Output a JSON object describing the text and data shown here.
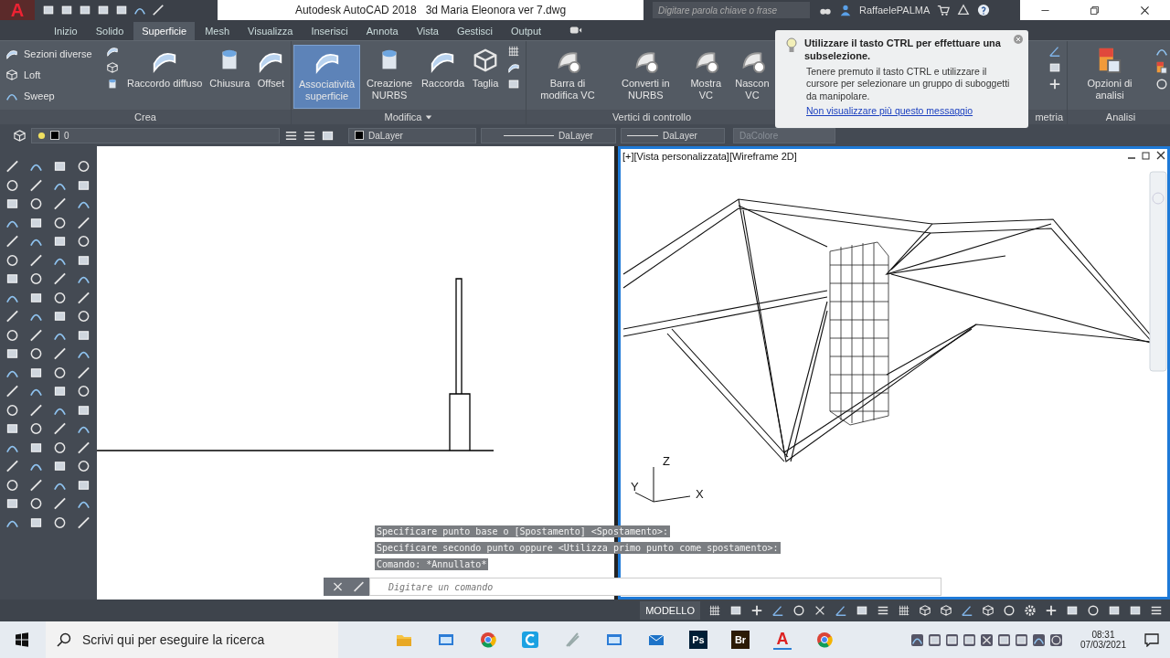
{
  "title_bar": {
    "logo": "A",
    "title": "Autodesk AutoCAD 2018",
    "file": "3d Maria Eleonora ver 7.dwg",
    "search": {
      "placeholder": "Digitare parola chiave o frase"
    },
    "user": "RaffaelePALMA"
  },
  "tabs": [
    {
      "label": "Inizio",
      "selected": false
    },
    {
      "label": "Solido",
      "selected": false
    },
    {
      "label": "Superficie",
      "selected": true
    },
    {
      "label": "Mesh",
      "selected": false
    },
    {
      "label": "Visualizza",
      "selected": false
    },
    {
      "label": "Inserisci",
      "selected": false
    },
    {
      "label": "Annota",
      "selected": false
    },
    {
      "label": "Vista",
      "selected": false
    },
    {
      "label": "Gestisci",
      "selected": false
    },
    {
      "label": "Output",
      "selected": false
    }
  ],
  "ribbon": {
    "panels": [
      {
        "label": "Crea",
        "small": [
          {
            "label": "Sezioni diverse"
          },
          {
            "label": "Loft"
          },
          {
            "label": "Sweep"
          }
        ],
        "buttons": [
          {
            "label": "Raccordo diffuso",
            "selected": false
          },
          {
            "label": "Chiusura",
            "selected": false
          },
          {
            "label": "Offset",
            "selected": false
          }
        ]
      },
      {
        "label": "Modifica",
        "dropdown": true,
        "buttons": [
          {
            "label": "Associatività superficie",
            "selected": true
          },
          {
            "label": "Creazione NURBS",
            "selected": false
          },
          {
            "label": "Raccorda",
            "selected": false
          },
          {
            "label": "Taglia",
            "selected": false
          }
        ]
      },
      {
        "label": "Vertici di controllo",
        "buttons": [
          {
            "label": "Barra di modifica VC",
            "selected": false
          },
          {
            "label": "Converti in NURBS",
            "selected": false
          },
          {
            "label": "Mostra VC",
            "selected": false
          },
          {
            "label": "Nascon VC",
            "selected": false
          }
        ]
      },
      {
        "label": "metria"
      },
      {
        "label": "Analisi",
        "buttons": [
          {
            "label": "Opzioni di analisi",
            "selected": false
          }
        ]
      }
    ]
  },
  "tip": {
    "title": "Utilizzare il tasto CTRL per effettuare una subselezione.",
    "body": "Tenere premuto il tasto CTRL e utilizzare il cursore per selezionare un gruppo di suboggetti da manipolare.",
    "link": "Non visualizzare più questo messaggio"
  },
  "properties": {
    "layer": "0",
    "color_setting": "DaLayer",
    "linetype": "DaLayer",
    "lineweight": "DaLayer",
    "plot_style": {
      "value": "DaColore",
      "disabled": true
    }
  },
  "viewport": {
    "label": "[+][Vista personalizzata][Wireframe 2D]",
    "axes": [
      "Z",
      "Y",
      "X"
    ]
  },
  "command": {
    "history": [
      "Specificare punto base o [Spostamento] <Spostamento>:",
      "Specificare secondo punto oppure <Utilizza primo punto come spostamento>:",
      "Comando: *Annullato*"
    ],
    "placeholder": "Digitare un comando"
  },
  "status_bar": {
    "mode": "MODELLO"
  },
  "taskbar": {
    "search": {
      "placeholder": "Scrivi qui per eseguire la ricerca"
    },
    "apps": [
      {
        "kind": "folder"
      },
      {
        "kind": "window"
      },
      {
        "kind": "chrome"
      },
      {
        "kind": "ring",
        "color": "#1ba1e2"
      },
      {
        "kind": "brush"
      },
      {
        "kind": "window"
      },
      {
        "kind": "mail"
      },
      {
        "kind": "badge",
        "label": "Ps",
        "color": "#001e36"
      },
      {
        "kind": "badge",
        "label": "Br",
        "color": "#2b1a05"
      },
      {
        "kind": "autocad",
        "label": "A",
        "selected": true
      },
      {
        "kind": "chrome"
      }
    ],
    "time": "08:31",
    "date": "07/03/2021"
  }
}
